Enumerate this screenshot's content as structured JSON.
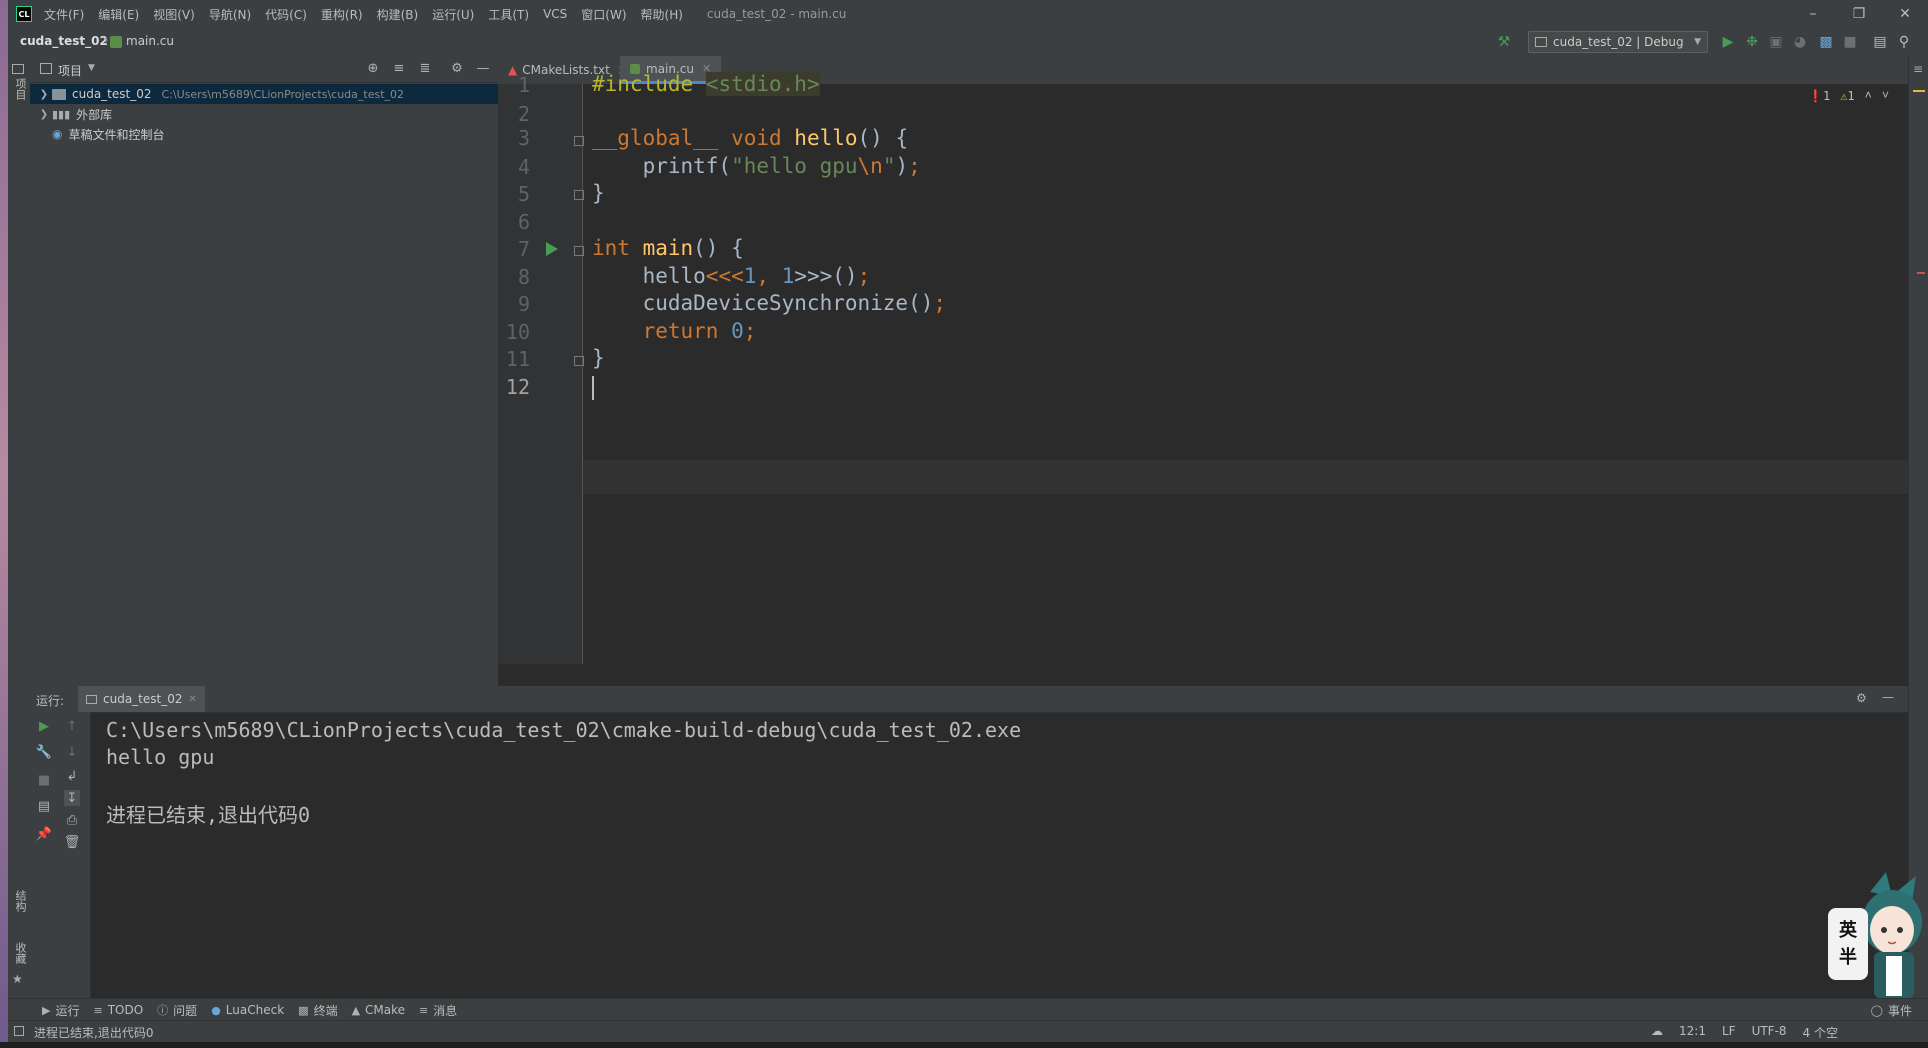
{
  "menu": [
    "文件(F)",
    "编辑(E)",
    "视图(V)",
    "导航(N)",
    "代码(C)",
    "重构(R)",
    "构建(B)",
    "运行(U)",
    "工具(T)",
    "VCS",
    "窗口(W)",
    "帮助(H)"
  ],
  "window_title": "cuda_test_02 - main.cu",
  "breadcrumb": {
    "project": "cuda_test_02",
    "file": "main.cu"
  },
  "run_config": "cuda_test_02 | Debug",
  "left_stripe": {
    "project": "项目",
    "structure": "结构",
    "favorites": "收藏"
  },
  "project_panel": {
    "title": "项目",
    "tree": [
      {
        "label": "cuda_test_02",
        "path": "C:\\Users\\m5689\\CLionProjects\\cuda_test_02",
        "selected": true
      },
      {
        "label": "外部库",
        "path": ""
      },
      {
        "label": "草稿文件和控制台",
        "path": ""
      }
    ]
  },
  "editor_tabs": [
    {
      "label": "CMakeLists.txt",
      "active": false
    },
    {
      "label": "main.cu",
      "active": true
    }
  ],
  "inspections": {
    "errors": "1",
    "warnings": "1"
  },
  "code": {
    "line_numbers": [
      "1",
      "2",
      "3",
      "4",
      "5",
      "6",
      "7",
      "8",
      "9",
      "10",
      "11",
      "12"
    ],
    "l1_directive": "#include ",
    "l1_header": "<stdio.h>",
    "l3_global": "__global__ ",
    "l3_void": "void ",
    "l3_fn": "hello",
    "l3_rest": "() {",
    "l4_indent": "    ",
    "l4_fn": "printf(",
    "l4_str": "\"hello gpu",
    "l4_esc": "\\n",
    "l4_strend": "\"",
    "l4_end": ")",
    "l4_semi": ";",
    "l5": "}",
    "l7_int": "int ",
    "l7_fn": "main",
    "l7_rest": "() {",
    "l8_call": "    hello",
    "l8_open": "<<<",
    "l8_n1": "1",
    "l8_comma": ", ",
    "l8_n2": "1",
    "l8_close": ">>>",
    "l8_rest": "()",
    "l8_semi": ";",
    "l9_call": "    cudaDeviceSynchronize()",
    "l9_semi": ";",
    "l10_indent": "    ",
    "l10_kw": "return ",
    "l10_num": "0",
    "l10_semi": ";",
    "l11": "}"
  },
  "run_panel": {
    "label": "运行:",
    "tab": "cuda_test_02",
    "console": [
      "C:\\Users\\m5689\\CLionProjects\\cuda_test_02\\cmake-build-debug\\cuda_test_02.exe",
      "hello gpu",
      "",
      "进程已结束,退出代码0"
    ]
  },
  "bottom_tools": [
    "运行",
    "TODO",
    "问题",
    "LuaCheck",
    "终端",
    "CMake",
    "消息"
  ],
  "status_bar": {
    "message": "进程已结束,退出代码0",
    "position": "12:1",
    "line_sep": "LF",
    "encoding": "UTF-8",
    "indent": "4 个空",
    "event_log": "事件"
  },
  "ime": {
    "lang": "英",
    "width": "半"
  },
  "colors": {
    "background": "#2b2b2b",
    "panel": "#3c3f41",
    "keyword": "#cc7832",
    "function": "#ffc66d",
    "string": "#6a8759",
    "number": "#6897bb",
    "accent": "#4a88c7"
  }
}
